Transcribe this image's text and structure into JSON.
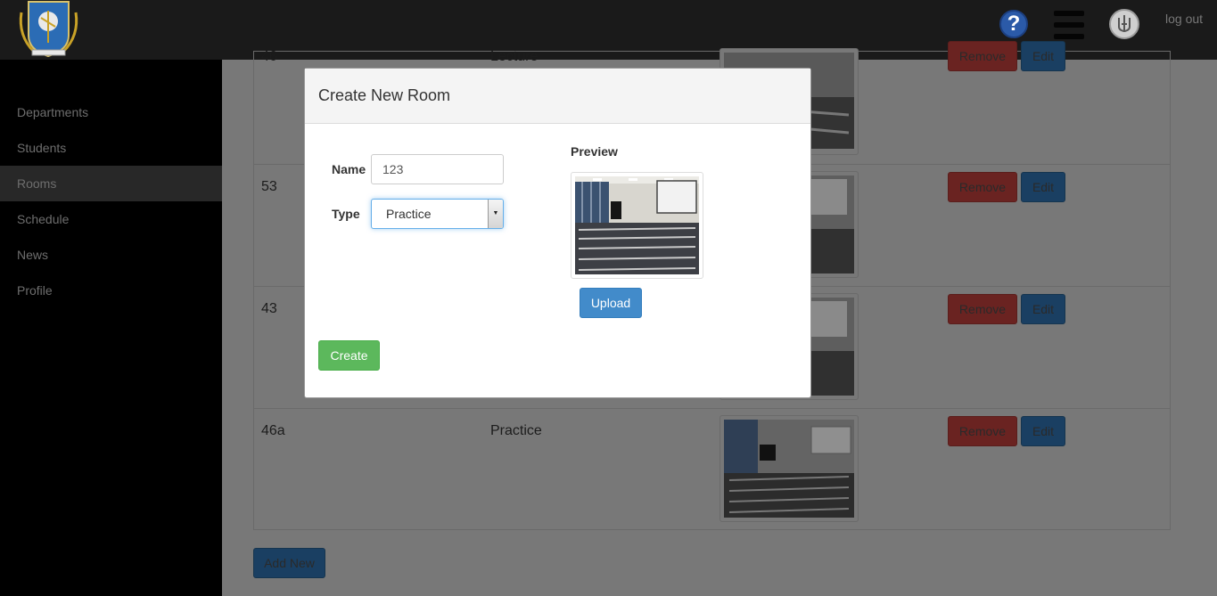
{
  "header": {
    "help_icon": "question-circle-icon",
    "help_glyph": "?",
    "menu_icon": "hamburger-menu-icon",
    "emblem_icon": "trident-emblem-icon",
    "logout_label": "log out"
  },
  "sidebar": {
    "items": [
      {
        "label": "Departments",
        "active": false
      },
      {
        "label": "Students",
        "active": false
      },
      {
        "label": "Rooms",
        "active": true
      },
      {
        "label": "Schedule",
        "active": false
      },
      {
        "label": "News",
        "active": false
      },
      {
        "label": "Profile",
        "active": false
      }
    ]
  },
  "rooms": {
    "rows": [
      {
        "name": "46",
        "type": "Lecture"
      },
      {
        "name": "53",
        "type": ""
      },
      {
        "name": "43",
        "type": ""
      },
      {
        "name": "46a",
        "type": "Practice"
      }
    ],
    "remove_label": "Remove",
    "edit_label": "Edit",
    "add_label": "Add New"
  },
  "modal": {
    "title": "Create New Room",
    "name_label": "Name",
    "name_value": "123",
    "type_label": "Type",
    "type_value": "Practice",
    "preview_label": "Preview",
    "upload_label": "Upload",
    "create_label": "Create"
  },
  "colors": {
    "primary": "#428bca",
    "success": "#5cb85c",
    "danger": "#d9534f"
  }
}
